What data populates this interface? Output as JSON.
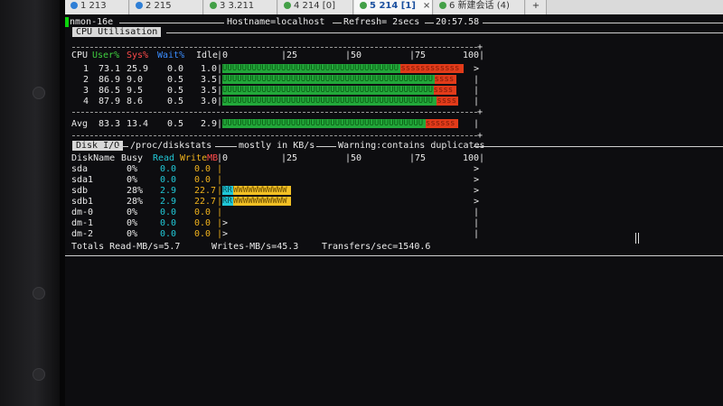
{
  "tabs": [
    {
      "label": "1 213",
      "color": "#2f7fd6"
    },
    {
      "label": "2 215",
      "color": "#2f7fd6"
    },
    {
      "label": "3 3.211",
      "color": "#43a047"
    },
    {
      "label": "4 214 [0]",
      "color": "#43a047"
    },
    {
      "label": "5 214 [1]",
      "color": "#43a047",
      "close": "×",
      "active": true
    },
    {
      "label": "6 新建会话 (4)",
      "color": "#43a047"
    }
  ],
  "tab_add": "+",
  "header": {
    "title": "nmon-16e",
    "hostname": "Hostname=localhost",
    "refresh": "Refresh= 2secs",
    "time": "20:57.58"
  },
  "cpu": {
    "section_title": "CPU Utilisation",
    "columns": {
      "cpu": "CPU",
      "user": "User%",
      "sys": "Sys%",
      "wait": "Wait%",
      "idle": "Idle"
    },
    "scale": [
      "0",
      "|25",
      "|50",
      "|75",
      "100|"
    ],
    "rows": [
      {
        "cpu": "1",
        "user": "73.1",
        "sys": "25.9",
        "wait": "0.0",
        "idle": "1.0",
        "user_pct": 73.1,
        "sys_pct": 25.9,
        "end": ">"
      },
      {
        "cpu": "2",
        "user": "86.9",
        "sys": "9.0",
        "wait": "0.5",
        "idle": "3.5",
        "user_pct": 86.9,
        "sys_pct": 9.0,
        "end": "|"
      },
      {
        "cpu": "3",
        "user": "86.5",
        "sys": "9.5",
        "wait": "0.5",
        "idle": "3.5",
        "user_pct": 86.5,
        "sys_pct": 9.5,
        "end": "|"
      },
      {
        "cpu": "4",
        "user": "87.9",
        "sys": "8.6",
        "wait": "0.5",
        "idle": "3.0",
        "user_pct": 87.9,
        "sys_pct": 8.6,
        "end": "|"
      }
    ],
    "avg": {
      "label": "Avg",
      "user": "83.3",
      "sys": "13.4",
      "wait": "0.5",
      "idle": "2.9",
      "user_pct": 83.3,
      "sys_pct": 13.4,
      "end": "|"
    }
  },
  "disk": {
    "section_title": "Disk I/O",
    "path": "/proc/diskstats",
    "units": "mostly in KB/s",
    "warning": "Warning:contains duplicates",
    "columns": {
      "name": "DiskName",
      "busy": "Busy",
      "read": "Read",
      "write": "Write",
      "mb": "MB"
    },
    "scale": [
      "0",
      "|25",
      "|50",
      "|75",
      "100|"
    ],
    "rows": [
      {
        "name": "sda",
        "busy": "0%",
        "read": "0.0",
        "write": "0.0",
        "end": ">",
        "busy_pct": 0
      },
      {
        "name": "sda1",
        "busy": "0%",
        "read": "0.0",
        "write": "0.0",
        "end": ">",
        "busy_pct": 0
      },
      {
        "name": "sdb",
        "busy": "28%",
        "read": "2.9",
        "write": "22.7",
        "end": ">",
        "busy_pct": 28
      },
      {
        "name": "sdb1",
        "busy": "28%",
        "read": "2.9",
        "write": "22.7",
        "end": ">",
        "busy_pct": 28
      },
      {
        "name": "dm-0",
        "busy": "0%",
        "read": "0.0",
        "write": "0.0",
        "end": "|",
        "busy_pct": 0
      },
      {
        "name": "dm-1",
        "busy": "0%",
        "read": "0.0",
        "write": "0.0",
        "end": "|",
        "busy_pct": 0,
        "mark": ">"
      },
      {
        "name": "dm-2",
        "busy": "0%",
        "read": "0.0",
        "write": "0.0",
        "end": "|",
        "busy_pct": 0,
        "mark": ">"
      }
    ],
    "totals": {
      "read": "Totals Read-MB/s=5.7",
      "write": "Writes-MB/s=45.3",
      "transfers": "Transfers/sec=1540.6"
    }
  },
  "colors": {
    "user": "#22a83a",
    "sys": "#e23b1a",
    "read": "#20c7d8",
    "write": "#f2c025"
  }
}
